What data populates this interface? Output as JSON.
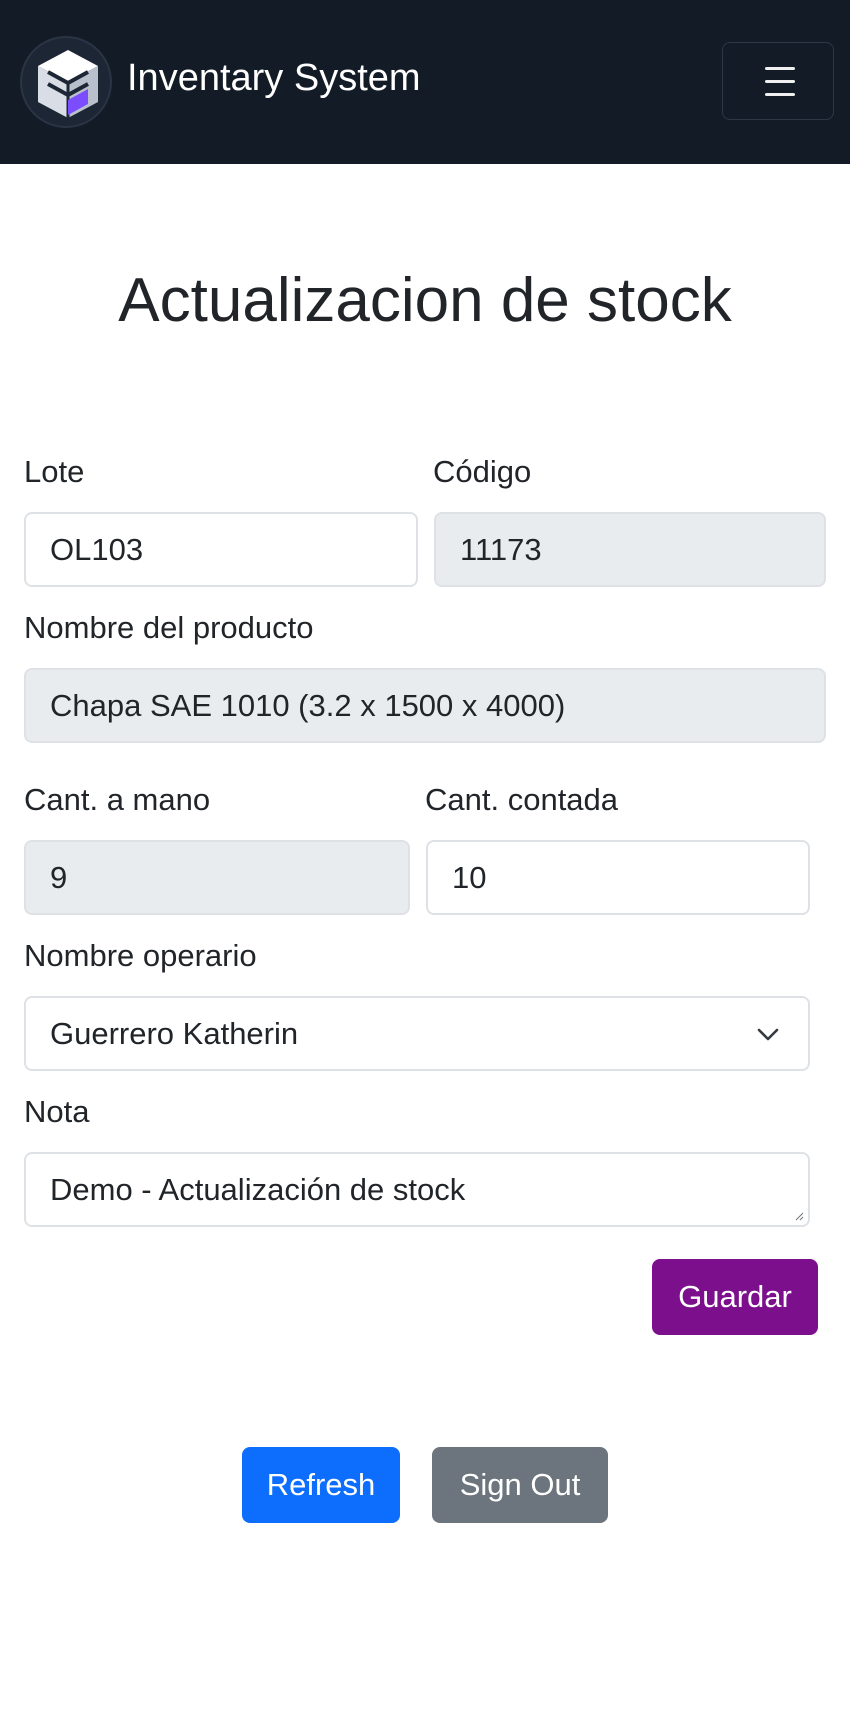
{
  "navbar": {
    "brand": "Inventary System",
    "logo_icon": "cube-logo-icon",
    "toggler_icon": "hamburger-menu-icon",
    "colors": {
      "background": "#121b26",
      "logo_accent": "#7c4dff"
    }
  },
  "page": {
    "title": "Actualizacion de stock"
  },
  "form": {
    "lote": {
      "label": "Lote",
      "value": "OL103"
    },
    "codigo": {
      "label": "Código",
      "value": "11173"
    },
    "producto": {
      "label": "Nombre del producto",
      "value": "Chapa SAE 1010 (3.2 x 1500 x 4000)"
    },
    "cant_mano": {
      "label": "Cant. a mano",
      "value": "9"
    },
    "cant_contada": {
      "label": "Cant. contada",
      "value": "10"
    },
    "operario": {
      "label": "Nombre operario",
      "value": "Guerrero Katherin",
      "icon": "chevron-down-icon"
    },
    "nota": {
      "label": "Nota",
      "value": "Demo - Actualización de stock"
    },
    "save_label": "Guardar"
  },
  "actions": {
    "refresh_label": "Refresh",
    "signout_label": "Sign Out"
  },
  "colors": {
    "primary": "#0d6efd",
    "secondary": "#6c757d",
    "save": "#7b0f8c",
    "readonly_bg": "#e9ecef"
  }
}
